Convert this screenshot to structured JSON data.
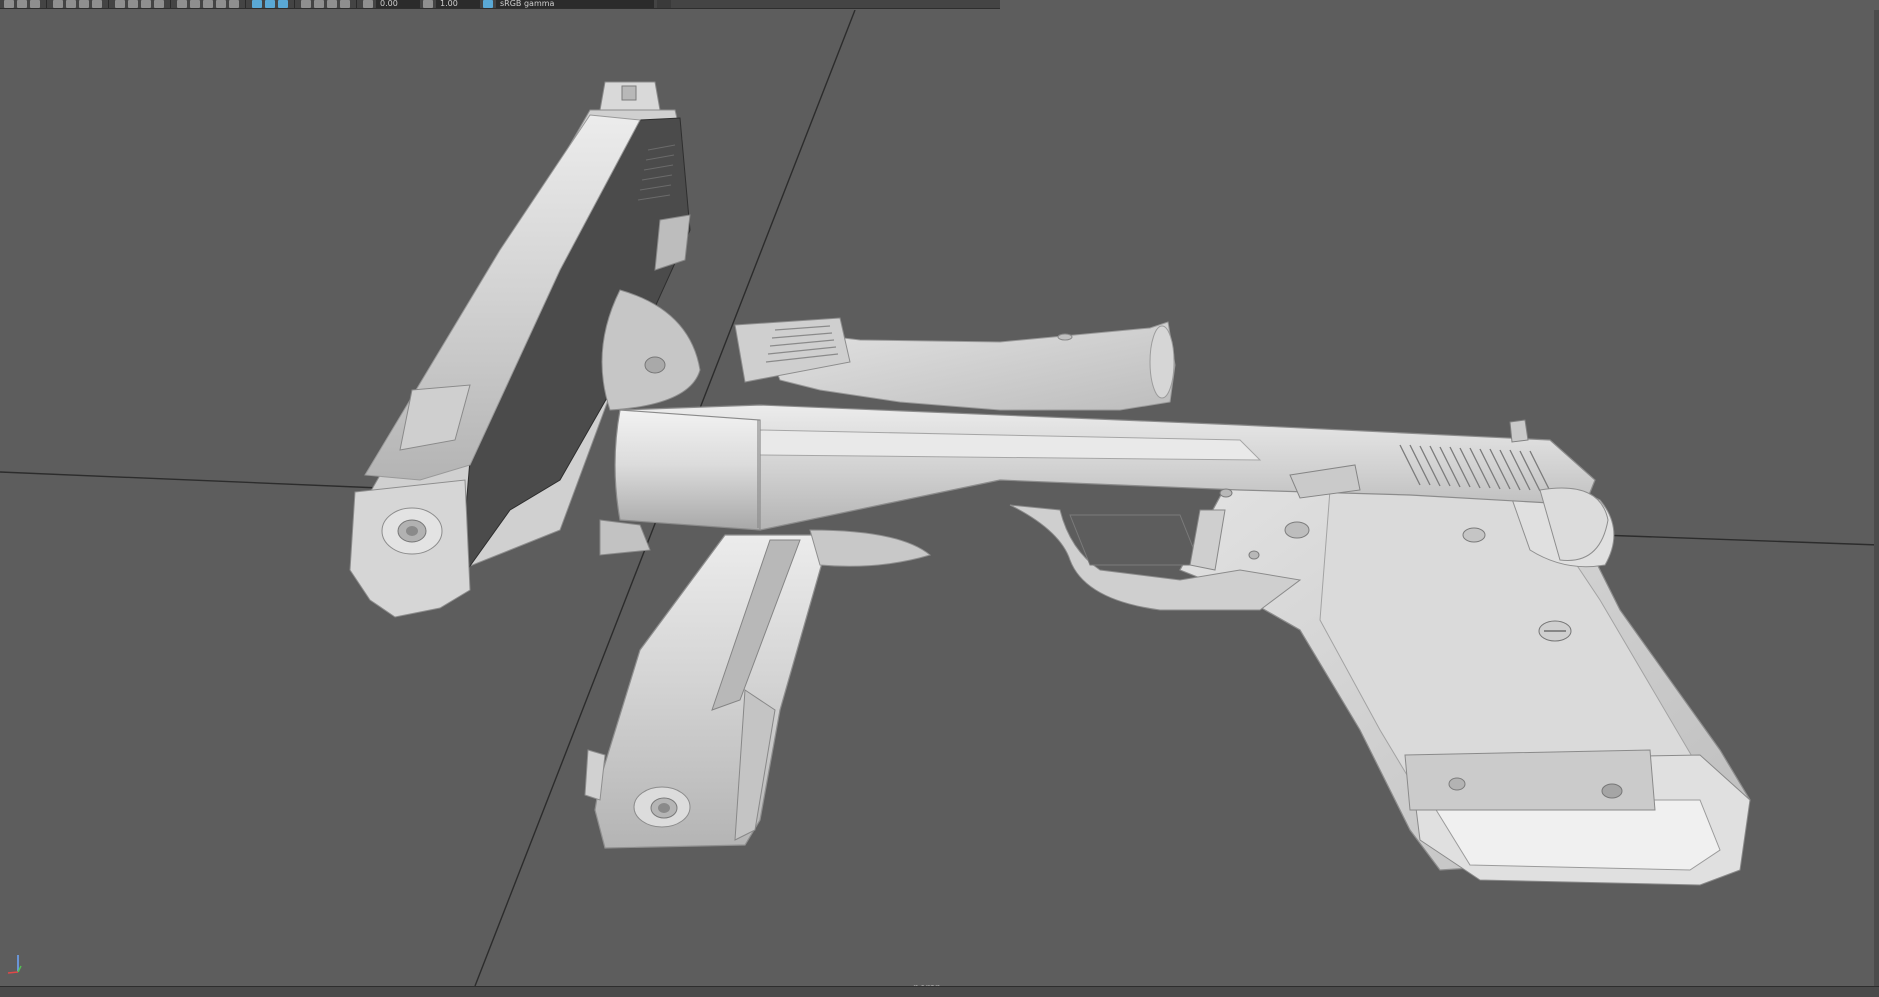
{
  "toolbar": {
    "exposure_value": "0.00",
    "gamma_value": "1.00",
    "color_space": "sRGB gamma"
  },
  "viewport": {
    "camera_label": "persp"
  },
  "colors": {
    "viewport_bg": "#5d5d5d",
    "toolbar_bg": "#444444",
    "active_icon": "#5aa9d6",
    "model_light": "#d8d8d8",
    "model_dark": "#4a4a4a"
  },
  "icons": [
    "select-icon",
    "lasso-icon",
    "paint-icon",
    "move-icon",
    "rotate-icon",
    "scale-icon",
    "camera-icon",
    "grid-icon",
    "wireframe-icon",
    "shaded-icon",
    "textured-icon",
    "lights-icon",
    "shadows-icon",
    "ao-icon",
    "isolate-icon",
    "xray-icon",
    "exposure-icon",
    "gamma-icon",
    "color-management-icon"
  ]
}
